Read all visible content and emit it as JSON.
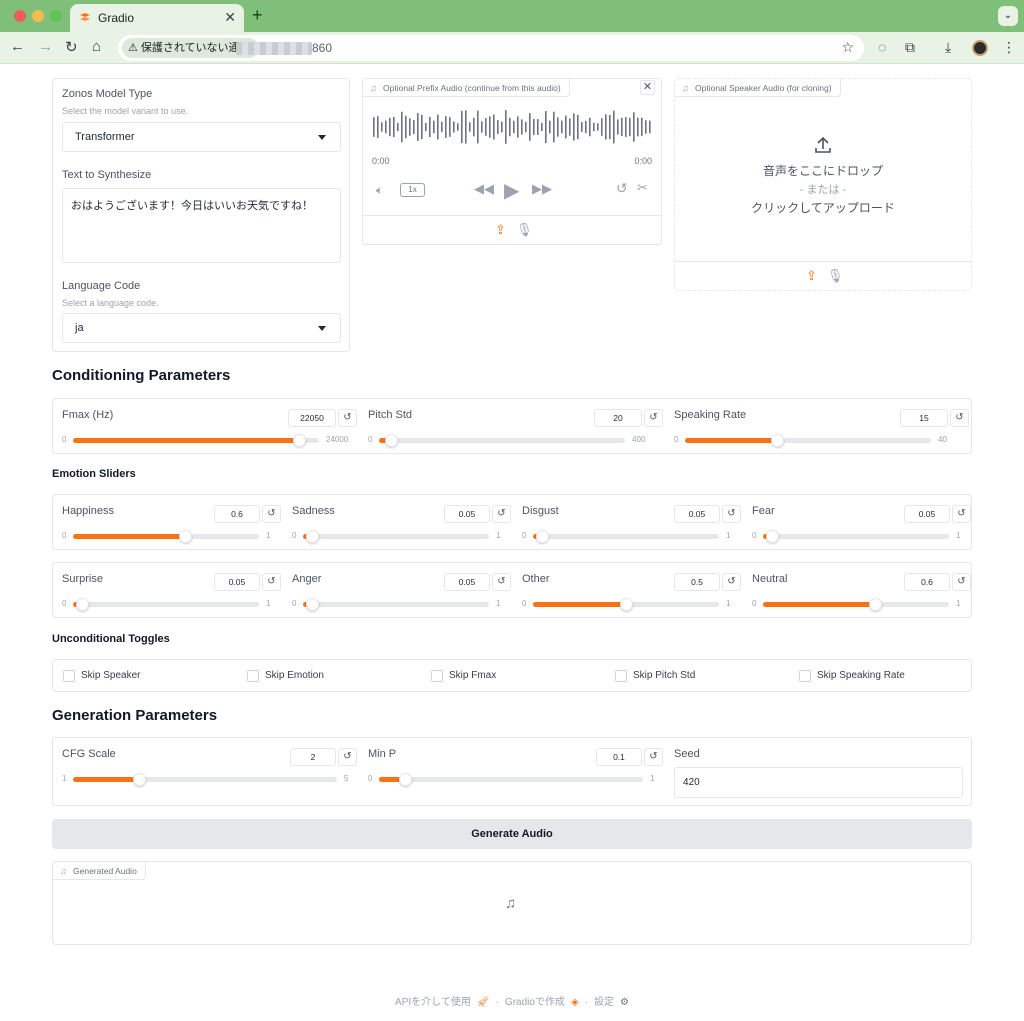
{
  "browser": {
    "tab_title": "Gradio",
    "security_label": "保護されていない通信",
    "url_suffix": "860"
  },
  "inputs": {
    "model_type": {
      "label": "Zonos Model Type",
      "info": "Select the model variant to use.",
      "value": "Transformer"
    },
    "text": {
      "label": "Text to Synthesize",
      "value": "おはようございます！今日はいいお天気ですね！"
    },
    "language": {
      "label": "Language Code",
      "info": "Select a language code.",
      "value": "ja"
    },
    "prefix_audio": {
      "label": "Optional Prefix Audio (continue from this audio)",
      "time_start": "0:00",
      "time_end": "0:00",
      "speed": "1x"
    },
    "speaker_audio": {
      "label": "Optional Speaker Audio (for cloning)",
      "drop_text": "音声をここにドロップ",
      "or_text": "- または -",
      "click_text": "クリックしてアップロード"
    }
  },
  "conditioning": {
    "title": "Conditioning Parameters",
    "sliders": [
      {
        "label": "Fmax (Hz)",
        "value": 22050,
        "min": 0,
        "max": 24000
      },
      {
        "label": "Pitch Std",
        "value": 20,
        "min": 0,
        "max": 400
      },
      {
        "label": "Speaking Rate",
        "value": 15,
        "min": 0,
        "max": 40
      }
    ]
  },
  "emotion": {
    "title": "Emotion Sliders",
    "sliders": [
      {
        "label": "Happiness",
        "value": 0.6,
        "min": 0,
        "max": 1
      },
      {
        "label": "Sadness",
        "value": 0.05,
        "min": 0,
        "max": 1
      },
      {
        "label": "Disgust",
        "value": 0.05,
        "min": 0,
        "max": 1
      },
      {
        "label": "Fear",
        "value": 0.05,
        "min": 0,
        "max": 1
      },
      {
        "label": "Surprise",
        "value": 0.05,
        "min": 0,
        "max": 1
      },
      {
        "label": "Anger",
        "value": 0.05,
        "min": 0,
        "max": 1
      },
      {
        "label": "Other",
        "value": 0.5,
        "min": 0,
        "max": 1
      },
      {
        "label": "Neutral",
        "value": 0.6,
        "min": 0,
        "max": 1
      }
    ]
  },
  "toggles": {
    "title": "Unconditional Toggles",
    "items": [
      "Skip Speaker",
      "Skip Emotion",
      "Skip Fmax",
      "Skip Pitch Std",
      "Skip Speaking Rate"
    ]
  },
  "generation": {
    "title": "Generation Parameters",
    "sliders": [
      {
        "label": "CFG Scale",
        "value": 2,
        "min": 1,
        "max": 5
      },
      {
        "label": "Min P",
        "value": 0.1,
        "min": 0,
        "max": 1
      }
    ],
    "seed": {
      "label": "Seed",
      "value": "420"
    }
  },
  "generate_button": "Generate Audio",
  "output": {
    "label": "Generated Audio"
  },
  "footer": {
    "api": "APIを介して使用",
    "built": "Gradioで作成",
    "settings": "設定"
  },
  "colors": {
    "accent": "#f97316",
    "chrome": "#7fbf7a"
  }
}
